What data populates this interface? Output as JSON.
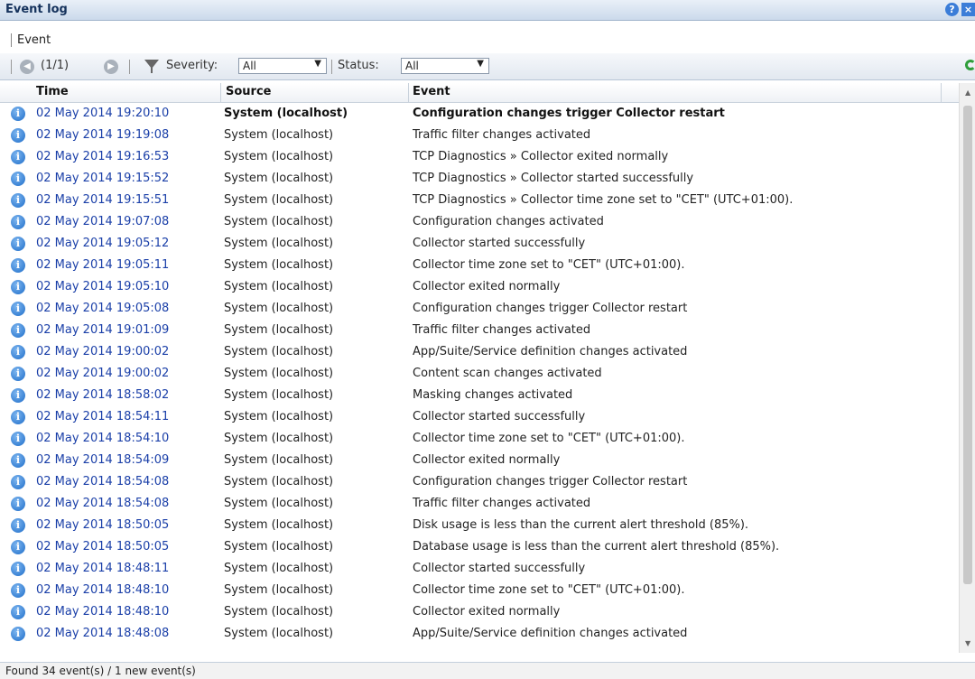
{
  "window": {
    "title": "Event log"
  },
  "tabs": [
    {
      "label": "Event"
    }
  ],
  "toolbar": {
    "page_indicator": "(1/1)",
    "severity_label": "Severity:",
    "severity_value": "All",
    "status_label": "Status:",
    "status_value": "All"
  },
  "columns": {
    "time": "Time",
    "source": "Source",
    "event": "Event"
  },
  "rows": [
    {
      "time": "02 May 2014 19:20:10",
      "source": "System (localhost)",
      "event": "Configuration changes trigger Collector restart",
      "bold": true
    },
    {
      "time": "02 May 2014 19:19:08",
      "source": "System (localhost)",
      "event": "Traffic filter changes activated"
    },
    {
      "time": "02 May 2014 19:16:53",
      "source": "System (localhost)",
      "event": "TCP Diagnostics » Collector exited normally"
    },
    {
      "time": "02 May 2014 19:15:52",
      "source": "System (localhost)",
      "event": "TCP Diagnostics » Collector started successfully"
    },
    {
      "time": "02 May 2014 19:15:51",
      "source": "System (localhost)",
      "event": "TCP Diagnostics » Collector time zone set to \"CET\" (UTC+01:00)."
    },
    {
      "time": "02 May 2014 19:07:08",
      "source": "System (localhost)",
      "event": "Configuration changes activated"
    },
    {
      "time": "02 May 2014 19:05:12",
      "source": "System (localhost)",
      "event": "Collector started successfully"
    },
    {
      "time": "02 May 2014 19:05:11",
      "source": "System (localhost)",
      "event": "Collector time zone set to \"CET\" (UTC+01:00)."
    },
    {
      "time": "02 May 2014 19:05:10",
      "source": "System (localhost)",
      "event": "Collector exited normally"
    },
    {
      "time": "02 May 2014 19:05:08",
      "source": "System (localhost)",
      "event": "Configuration changes trigger Collector restart"
    },
    {
      "time": "02 May 2014 19:01:09",
      "source": "System (localhost)",
      "event": "Traffic filter changes activated"
    },
    {
      "time": "02 May 2014 19:00:02",
      "source": "System (localhost)",
      "event": "App/Suite/Service definition changes activated"
    },
    {
      "time": "02 May 2014 19:00:02",
      "source": "System (localhost)",
      "event": "Content scan changes activated"
    },
    {
      "time": "02 May 2014 18:58:02",
      "source": "System (localhost)",
      "event": "Masking changes activated"
    },
    {
      "time": "02 May 2014 18:54:11",
      "source": "System (localhost)",
      "event": "Collector started successfully"
    },
    {
      "time": "02 May 2014 18:54:10",
      "source": "System (localhost)",
      "event": "Collector time zone set to \"CET\" (UTC+01:00)."
    },
    {
      "time": "02 May 2014 18:54:09",
      "source": "System (localhost)",
      "event": "Collector exited normally"
    },
    {
      "time": "02 May 2014 18:54:08",
      "source": "System (localhost)",
      "event": "Configuration changes trigger Collector restart"
    },
    {
      "time": "02 May 2014 18:54:08",
      "source": "System (localhost)",
      "event": "Traffic filter changes activated"
    },
    {
      "time": "02 May 2014 18:50:05",
      "source": "System (localhost)",
      "event": "Disk usage is less than the current alert threshold (85%)."
    },
    {
      "time": "02 May 2014 18:50:05",
      "source": "System (localhost)",
      "event": "Database usage is less than the current alert threshold (85%)."
    },
    {
      "time": "02 May 2014 18:48:11",
      "source": "System (localhost)",
      "event": "Collector started successfully"
    },
    {
      "time": "02 May 2014 18:48:10",
      "source": "System (localhost)",
      "event": "Collector time zone set to \"CET\" (UTC+01:00)."
    },
    {
      "time": "02 May 2014 18:48:10",
      "source": "System (localhost)",
      "event": "Collector exited normally"
    },
    {
      "time": "02 May 2014 18:48:08",
      "source": "System (localhost)",
      "event": "App/Suite/Service definition changes activated"
    }
  ],
  "status": {
    "text": "Found 34 event(s) / 1 new event(s)"
  },
  "icons": {
    "row_icon": "info-icon",
    "help": "help-icon",
    "close": "close-icon",
    "refresh": "refresh-icon",
    "filter": "filter-icon"
  },
  "colors": {
    "time_link": "#1a3fa8",
    "info": "#1c6cc9",
    "refresh": "#2f9e3b"
  }
}
